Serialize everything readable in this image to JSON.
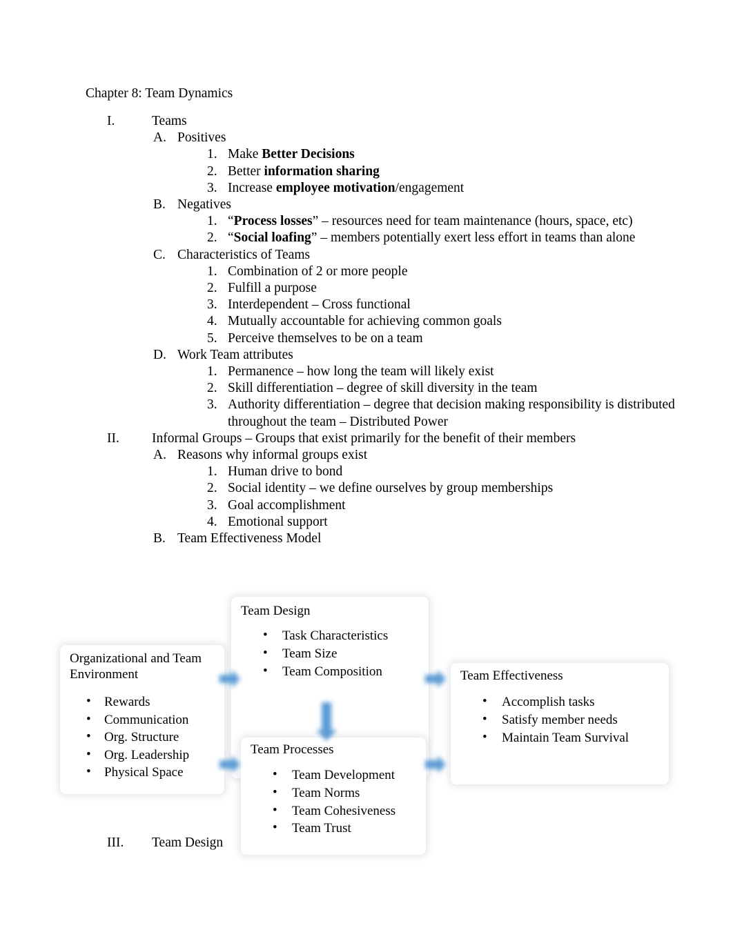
{
  "document": {
    "title": "Chapter 8: Team Dynamics"
  },
  "outline": [
    {
      "level": 1,
      "marker": "I.",
      "text": "Teams"
    },
    {
      "level": 2,
      "marker": "A.",
      "text": "Positives"
    },
    {
      "level": 3,
      "marker": "1.",
      "html": "Make <b>Better Decisions</b>"
    },
    {
      "level": 3,
      "marker": "2.",
      "html": "Better <b>information sharing</b>"
    },
    {
      "level": 3,
      "marker": "3.",
      "html": "Increase <b>employee motivation</b>/engagement"
    },
    {
      "level": 2,
      "marker": "B.",
      "text": "Negatives"
    },
    {
      "level": 3,
      "marker": "1.",
      "html": "“<b>Process losses</b>” – resources need for team maintenance (hours, space, etc)"
    },
    {
      "level": 3,
      "marker": "2.",
      "html": "“<b>Social loafing</b>” – members potentially exert less effort in teams than alone"
    },
    {
      "level": 2,
      "marker": "C.",
      "text": "Characteristics of Teams"
    },
    {
      "level": 3,
      "marker": "1.",
      "text": "Combination of 2 or more people"
    },
    {
      "level": 3,
      "marker": "2.",
      "text": "Fulfill a purpose"
    },
    {
      "level": 3,
      "marker": "3.",
      "text": "Interdependent – Cross functional"
    },
    {
      "level": 3,
      "marker": "4.",
      "text": "Mutually accountable for achieving common goals"
    },
    {
      "level": 3,
      "marker": "5.",
      "text": "Perceive themselves to be on a team"
    },
    {
      "level": 2,
      "marker": "D.",
      "text": "Work Team attributes"
    },
    {
      "level": 3,
      "marker": "1.",
      "text": "Permanence – how long the team will likely exist"
    },
    {
      "level": 3,
      "marker": "2.",
      "text": "Skill differentiation – degree of skill diversity in the team"
    },
    {
      "level": 3,
      "marker": "3.",
      "text": "Authority differentiation – degree that decision making responsibility is distributed throughout the team – Distributed Power"
    },
    {
      "level": 1,
      "marker": "II.",
      "text": "Informal Groups – Groups that exist primarily for the benefit of their members"
    },
    {
      "level": 2,
      "marker": "A.",
      "text": "Reasons why informal groups exist"
    },
    {
      "level": 3,
      "marker": "1.",
      "text": "Human drive to bond"
    },
    {
      "level": 3,
      "marker": "2.",
      "text": "Social identity – we define ourselves by group memberships"
    },
    {
      "level": 3,
      "marker": "3.",
      "text": "Goal accomplishment"
    },
    {
      "level": 3,
      "marker": "4.",
      "text": "Emotional support"
    },
    {
      "level": 2,
      "marker": "B.",
      "text": "Team Effectiveness Model"
    }
  ],
  "outline_tail": [
    {
      "level": 1,
      "marker": "III.",
      "text": "Team Design"
    }
  ],
  "diagram": {
    "name": "team-effectiveness-model",
    "accent_color": "#5B9BD5",
    "boxes": {
      "team_design": {
        "title": "Team Design",
        "items": [
          "Task Characteristics",
          "Team Size",
          "Team Composition"
        ]
      },
      "organizational_environment": {
        "title": "Organizational and Team Environment",
        "items": [
          "Rewards",
          "Communication",
          "Org. Structure",
          "Org. Leadership",
          "Physical Space"
        ]
      },
      "team_effectiveness": {
        "title": "Team Effectiveness",
        "items": [
          "Accomplish tasks",
          "Satisfy member needs",
          "Maintain Team Survival"
        ]
      },
      "team_processes": {
        "title": "Team Processes",
        "items": [
          "Team Development",
          "Team Norms",
          "Team Cohesiveness",
          "Team Trust"
        ]
      }
    },
    "connectors": [
      {
        "name": "env-to-design",
        "direction": "right"
      },
      {
        "name": "design-to-effectiveness",
        "direction": "right"
      },
      {
        "name": "env-to-processes",
        "direction": "right"
      },
      {
        "name": "processes-to-effectiveness",
        "direction": "right"
      },
      {
        "name": "design-to-processes",
        "direction": "down"
      }
    ]
  }
}
